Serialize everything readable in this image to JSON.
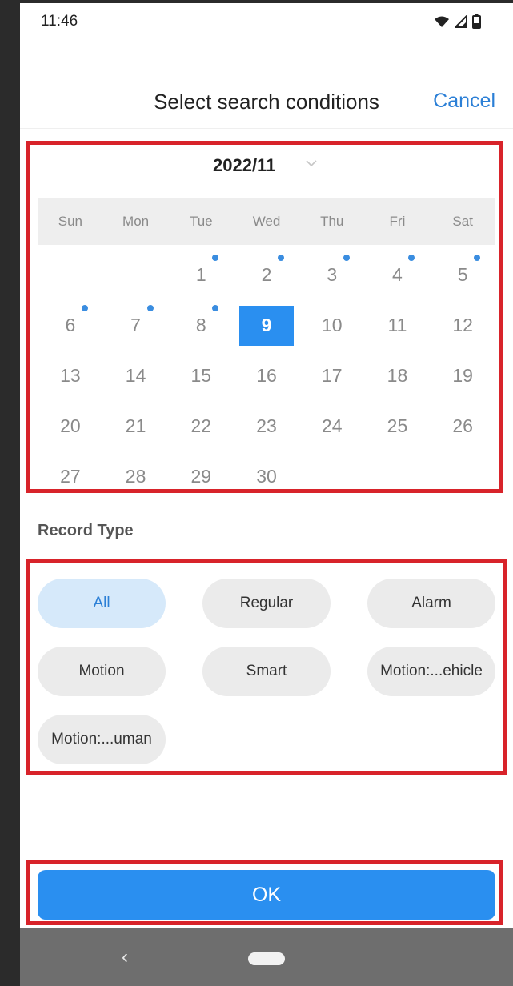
{
  "status_bar": {
    "time": "11:46",
    "icons": [
      "wifi-icon",
      "signal-icon",
      "battery-icon"
    ]
  },
  "header": {
    "title": "Select search conditions",
    "cancel_label": "Cancel"
  },
  "calendar": {
    "month_label": "2022/11",
    "weekdays": [
      "Sun",
      "Mon",
      "Tue",
      "Wed",
      "Thu",
      "Fri",
      "Sat"
    ],
    "weeks": [
      [
        "",
        "",
        "1",
        "2",
        "3",
        "4",
        "5"
      ],
      [
        "6",
        "7",
        "8",
        "9",
        "10",
        "11",
        "12"
      ],
      [
        "13",
        "14",
        "15",
        "16",
        "17",
        "18",
        "19"
      ],
      [
        "20",
        "21",
        "22",
        "23",
        "24",
        "25",
        "26"
      ],
      [
        "27",
        "28",
        "29",
        "30",
        "",
        "",
        ""
      ]
    ],
    "selected_day": "9",
    "days_with_records": [
      "1",
      "2",
      "3",
      "4",
      "5",
      "6",
      "7",
      "8"
    ]
  },
  "record_type": {
    "label": "Record Type",
    "options": [
      "All",
      "Regular",
      "Alarm",
      "Motion",
      "Smart",
      "Motion:...ehicle",
      "Motion:...uman"
    ],
    "selected": "All"
  },
  "ok_button": {
    "label": "OK"
  },
  "colors": {
    "accent": "#2a8ff0",
    "link": "#2b7fd6",
    "highlight_box": "#d8232a",
    "record_dot": "#3a8de0"
  }
}
